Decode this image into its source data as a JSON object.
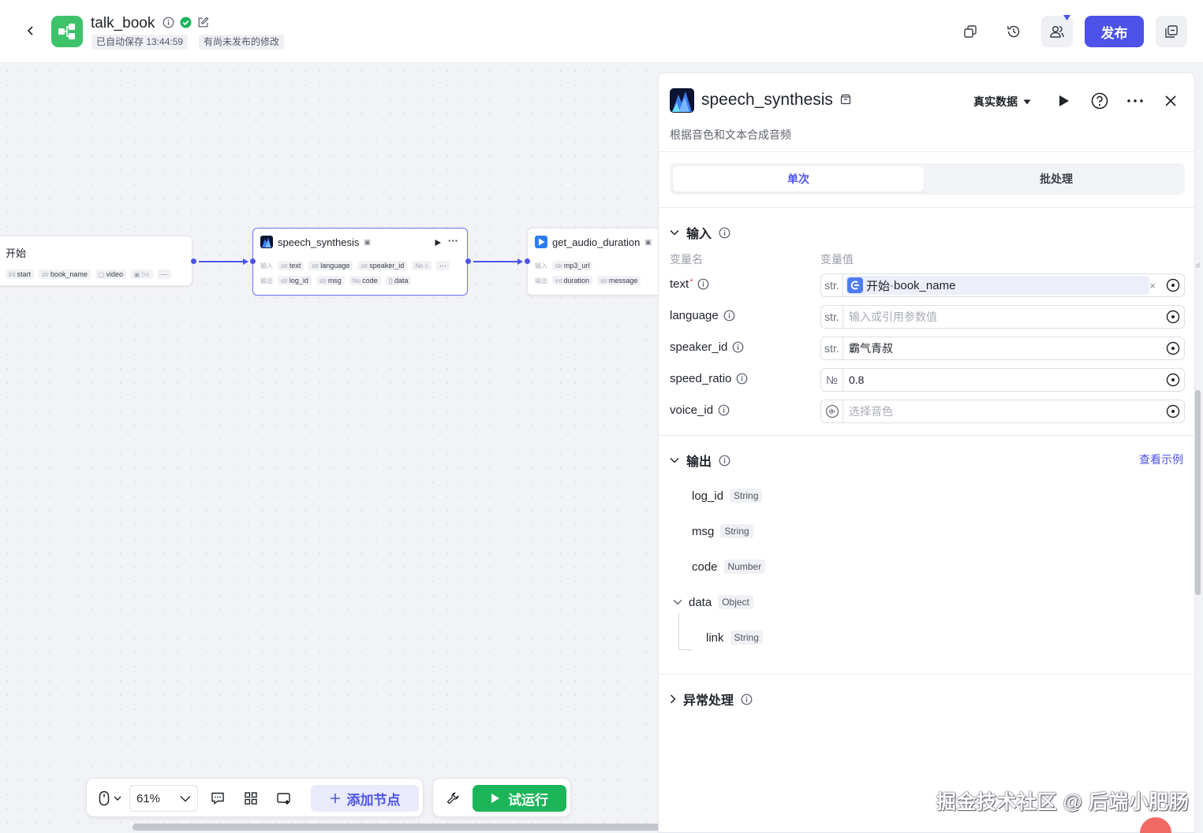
{
  "header": {
    "app_title": "talk_book",
    "autosave_text": "已自动保存 13:44:59",
    "unpublished_text": "有尚未发布的修改",
    "publish_label": "发布",
    "accent_color": "#4d53e8",
    "logo_color": "#3ec26a"
  },
  "canvas": {
    "nodes": {
      "start": {
        "title": "开始",
        "fields": [
          {
            "type": "int",
            "name": "start"
          },
          {
            "type": "str",
            "name": "book_name"
          },
          {
            "type": "",
            "name": "video"
          },
          {
            "type": "",
            "name": "ba"
          }
        ]
      },
      "speech": {
        "title": "speech_synthesis",
        "input_label": "输入",
        "output_label": "输出",
        "inputs": [
          {
            "type": "str",
            "name": "text"
          },
          {
            "type": "str",
            "name": "language"
          },
          {
            "type": "str",
            "name": "speaker_id"
          },
          {
            "type": "No",
            "name": "s"
          }
        ],
        "outputs": [
          {
            "type": "str",
            "name": "log_id"
          },
          {
            "type": "str",
            "name": "msg"
          },
          {
            "type": "No",
            "name": "code"
          },
          {
            "type": "{}",
            "name": "data"
          }
        ]
      },
      "audio": {
        "title": "get_audio_duration",
        "input_label": "输入",
        "output_label": "输出",
        "inputs": [
          {
            "type": "str",
            "name": "mp3_url"
          }
        ],
        "outputs": [
          {
            "type": "int",
            "name": "duration"
          },
          {
            "type": "str",
            "name": "message"
          }
        ]
      }
    },
    "more_glyph": "···",
    "edge_stub": "rl"
  },
  "toolbar": {
    "zoom_level": "61%",
    "add_node_label": "添加节点",
    "run_label": "试运行"
  },
  "panel": {
    "title": "speech_synthesis",
    "description": "根据音色和文本合成音频",
    "data_mode": "真实数据",
    "tabs": [
      {
        "label": "单次",
        "active": true
      },
      {
        "label": "批处理",
        "active": false
      }
    ],
    "input_section": {
      "title": "输入",
      "col_name": "变量名",
      "col_value": "变量值",
      "params": [
        {
          "name": "text",
          "required": true,
          "type_tag": "str.",
          "ref_source": "开始",
          "ref_sep": " - ",
          "ref_var": "book_name"
        },
        {
          "name": "language",
          "type_tag": "str.",
          "placeholder": "输入或引用参数值"
        },
        {
          "name": "speaker_id",
          "type_tag": "str.",
          "value": "霸气青叔"
        },
        {
          "name": "speed_ratio",
          "type_tag": "№",
          "value": "0.8"
        },
        {
          "name": "voice_id",
          "type_tag": "voice-icon",
          "placeholder": "选择音色"
        }
      ]
    },
    "output_section": {
      "title": "输出",
      "view_example": "查看示例",
      "fields": [
        {
          "name": "log_id",
          "type": "String"
        },
        {
          "name": "msg",
          "type": "String"
        },
        {
          "name": "code",
          "type": "Number"
        },
        {
          "name": "data",
          "type": "Object"
        },
        {
          "name": "link",
          "type": "String"
        }
      ]
    },
    "error_section": {
      "title": "异常处理"
    }
  },
  "watermark": "掘金技术社区 @ 后端小肥肠"
}
